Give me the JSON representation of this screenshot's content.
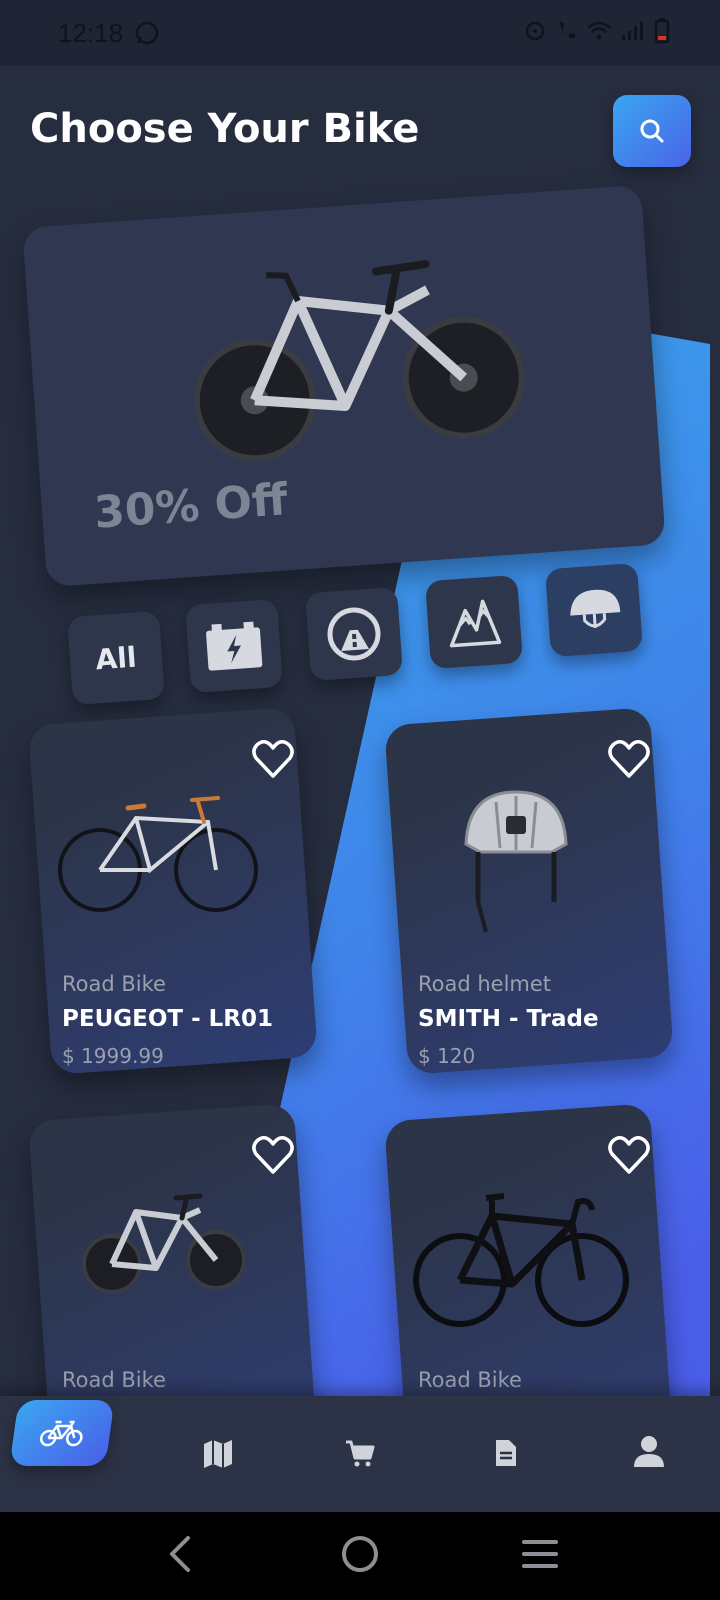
{
  "status_bar": {
    "time": "12:18"
  },
  "header": {
    "title": "Choose Your Bike",
    "search_icon": "search-icon"
  },
  "hero": {
    "offer": "30% Off",
    "image": "electric-bike"
  },
  "categories": [
    {
      "label": "All",
      "icon": ""
    },
    {
      "label": "",
      "icon": "battery-icon"
    },
    {
      "label": "",
      "icon": "road-icon"
    },
    {
      "label": "",
      "icon": "mountain-icon"
    },
    {
      "label": "",
      "icon": "helmet-icon"
    }
  ],
  "products": [
    {
      "category": "Road Bike",
      "name": "PEUGEOT - LR01",
      "price": "$ 1999.99",
      "image": "road-bike"
    },
    {
      "category": "Road helmet",
      "name": "SMITH - Trade",
      "price": "$ 120",
      "image": "helmet"
    },
    {
      "category": "Road Bike",
      "name": "",
      "price": "",
      "image": "electric-bike"
    },
    {
      "category": "Road Bike",
      "name": "",
      "price": "",
      "image": "black-road-bike"
    }
  ],
  "bottom_nav": [
    "bicycle-icon",
    "map-icon",
    "cart-icon",
    "document-icon",
    "profile-icon"
  ],
  "colors": {
    "accent_start": "#3aa6f0",
    "accent_end": "#4a64e8",
    "background": "#262d3f"
  }
}
